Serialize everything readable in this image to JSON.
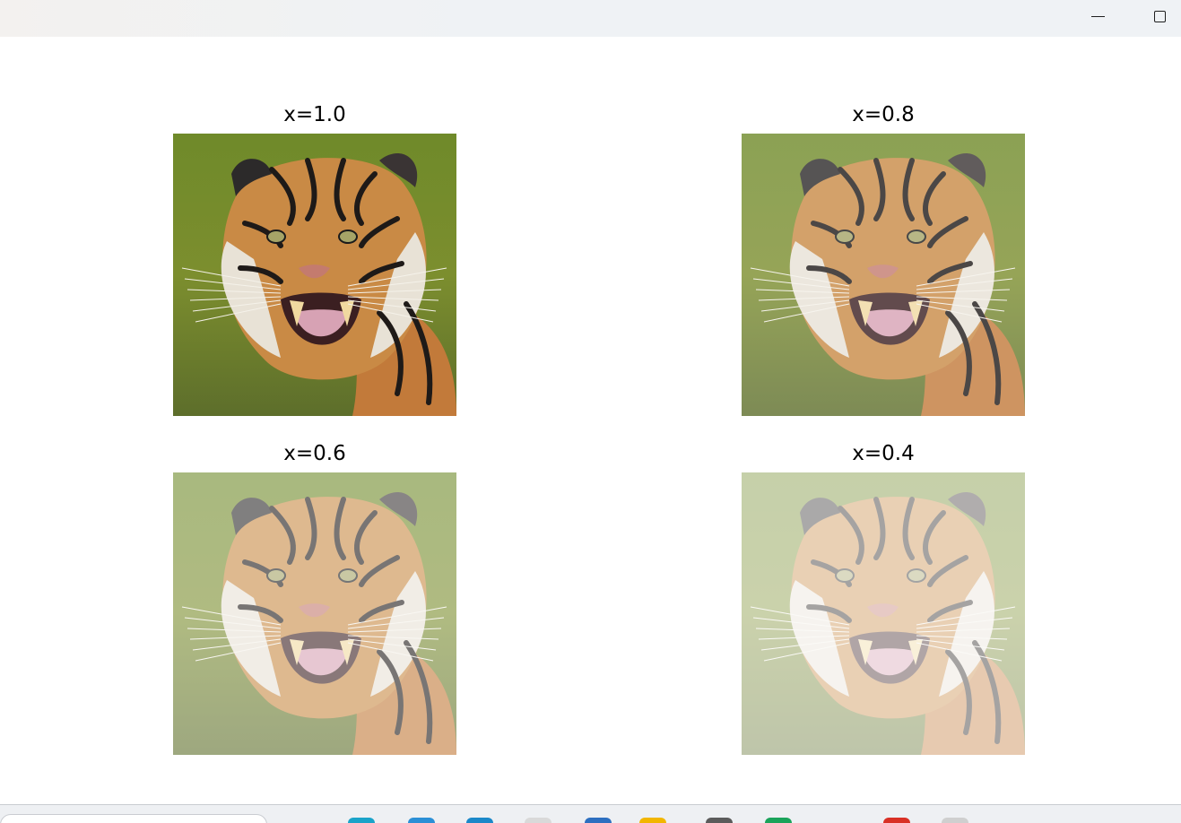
{
  "window": {
    "minimize_icon": "minimize-icon",
    "maximize_icon": "maximize-icon"
  },
  "figure": {
    "panels": [
      {
        "title": "x=1.0",
        "opacity": 1.0
      },
      {
        "title": "x=0.8",
        "opacity": 0.8
      },
      {
        "title": "x=0.6",
        "opacity": 0.6
      },
      {
        "title": "x=0.4",
        "opacity": 0.4
      }
    ]
  },
  "taskbar": {
    "icons": [
      "search-box",
      "browser-icon",
      "store-icon",
      "edge-icon",
      "file-icon",
      "mail-icon",
      "folder-icon",
      "app-icon",
      "app-icon-2",
      "chrome-icon",
      "tray-icon"
    ],
    "colors": [
      "#1aa3c9",
      "#2b8fd6",
      "#1b88c9",
      "#d9d9d9",
      "#2d6fc0",
      "#f2b600",
      "#5b5b5b",
      "#1aa35a",
      "#d93025",
      "#cfcfcf"
    ]
  }
}
